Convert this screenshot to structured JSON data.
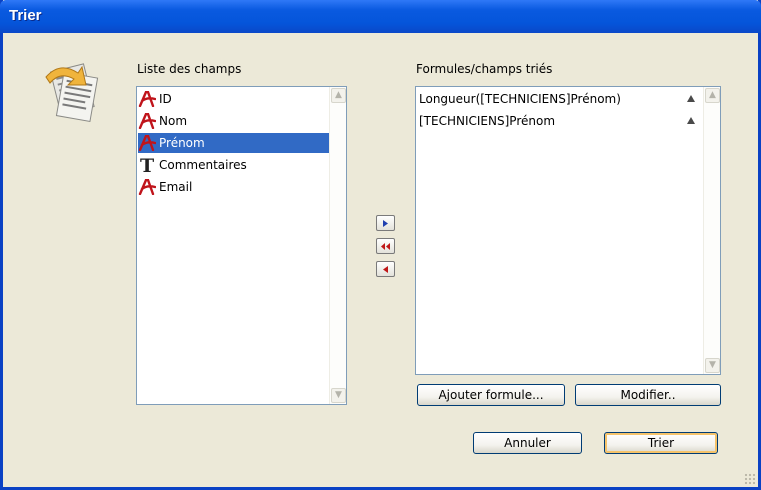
{
  "window": {
    "title": "Trier"
  },
  "fields_label": "Liste des champs",
  "sorted_label": "Formules/champs triés",
  "fields": [
    {
      "label": "ID",
      "icon": "alpha-field-icon",
      "selected": false
    },
    {
      "label": "Nom",
      "icon": "alpha-field-icon",
      "selected": false
    },
    {
      "label": "Prénom",
      "icon": "alpha-field-icon",
      "selected": true
    },
    {
      "label": "Commentaires",
      "icon": "text-field-icon",
      "selected": false
    },
    {
      "label": "Email",
      "icon": "alpha-field-icon",
      "selected": false
    }
  ],
  "sorted": [
    {
      "label": "Longueur([TECHNICIENS]Prénom)",
      "direction": "ascending"
    },
    {
      "label": "[TECHNICIENS]Prénom",
      "direction": "ascending"
    }
  ],
  "buttons": {
    "add_formula": "Ajouter formule...",
    "modify": "Modifier..",
    "cancel": "Annuler",
    "sort": "Trier"
  },
  "icons": {
    "add": "add-right-arrow-icon",
    "remove_all": "remove-all-double-arrow-icon",
    "remove": "remove-left-arrow-icon"
  },
  "colors": {
    "selection": "#316ac5",
    "titlebar": "#0555da",
    "alpha_icon": "#c0141b"
  }
}
